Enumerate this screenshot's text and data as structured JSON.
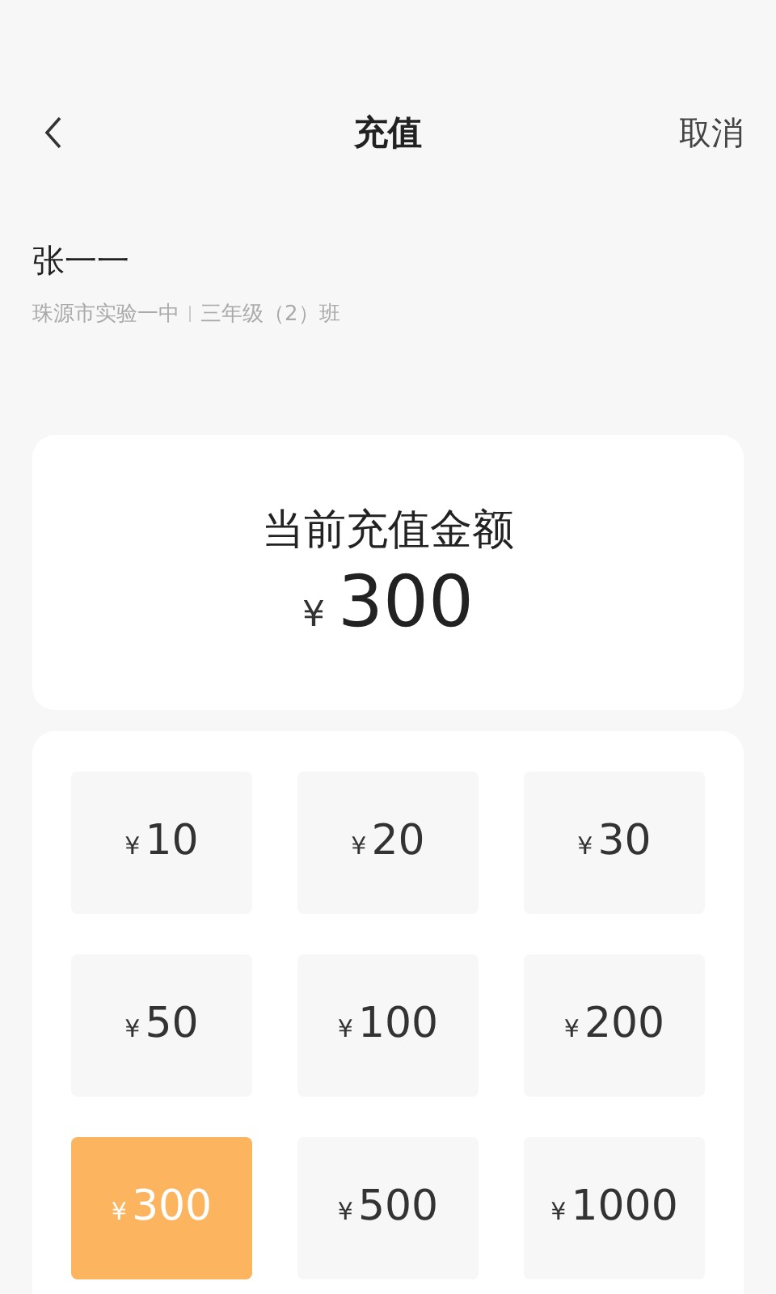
{
  "header": {
    "title": "充值",
    "cancel": "取消"
  },
  "student": {
    "name": "张一一",
    "school": "珠源市实验一中",
    "class": "三年级（2）班"
  },
  "current": {
    "label": "当前充值金额",
    "currency": "¥",
    "amount": "300"
  },
  "options": [
    {
      "currency": "¥",
      "amount": "10",
      "selected": false
    },
    {
      "currency": "¥",
      "amount": "20",
      "selected": false
    },
    {
      "currency": "¥",
      "amount": "30",
      "selected": false
    },
    {
      "currency": "¥",
      "amount": "50",
      "selected": false
    },
    {
      "currency": "¥",
      "amount": "100",
      "selected": false
    },
    {
      "currency": "¥",
      "amount": "200",
      "selected": false
    },
    {
      "currency": "¥",
      "amount": "300",
      "selected": true
    },
    {
      "currency": "¥",
      "amount": "500",
      "selected": false
    },
    {
      "currency": "¥",
      "amount": "1000",
      "selected": false
    }
  ]
}
